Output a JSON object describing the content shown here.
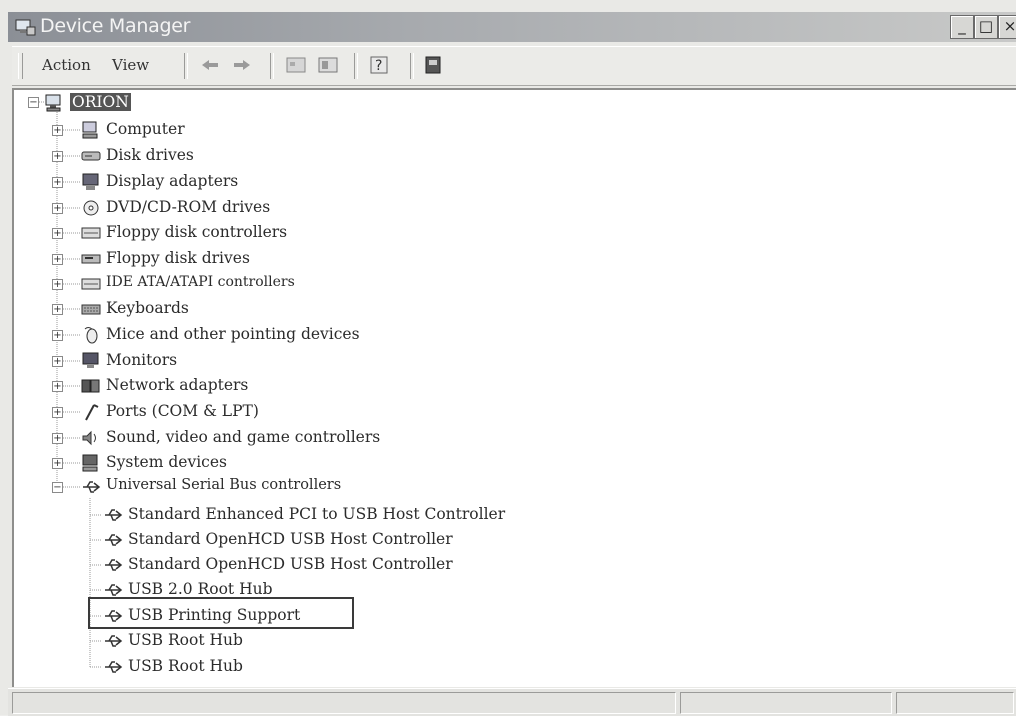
{
  "window": {
    "title": "Device Manager",
    "buttons": [
      "_",
      "□",
      "×"
    ]
  },
  "menu": {
    "action": "Action",
    "view": "View"
  },
  "toolbar": {
    "icons": [
      "back-icon",
      "forward-icon",
      "properties-icon",
      "show-hide-icon",
      "help-icon",
      "scan-hardware-icon"
    ]
  },
  "tree": {
    "root": {
      "label": "ORION",
      "icon": "computer-icon"
    },
    "categories": [
      {
        "label": "Computer",
        "icon": "computer-icon"
      },
      {
        "label": "Disk drives",
        "icon": "disk-drive-icon"
      },
      {
        "label": "Display adapters",
        "icon": "display-adapter-icon"
      },
      {
        "label": "DVD/CD-ROM drives",
        "icon": "cdrom-icon"
      },
      {
        "label": "Floppy disk controllers",
        "icon": "controller-icon"
      },
      {
        "label": "Floppy disk drives",
        "icon": "floppy-drive-icon"
      },
      {
        "label": "IDE ATA/ATAPI controllers",
        "icon": "controller-icon"
      },
      {
        "label": "Keyboards",
        "icon": "keyboard-icon"
      },
      {
        "label": "Mice and other pointing devices",
        "icon": "mouse-icon"
      },
      {
        "label": "Monitors",
        "icon": "monitor-icon"
      },
      {
        "label": "Network adapters",
        "icon": "network-adapter-icon"
      },
      {
        "label": "Ports (COM & LPT)",
        "icon": "port-icon"
      },
      {
        "label": "Sound, video and game controllers",
        "icon": "sound-icon"
      },
      {
        "label": "System devices",
        "icon": "system-device-icon"
      },
      {
        "label": "Universal Serial Bus controllers",
        "icon": "usb-icon"
      }
    ],
    "usb_children": [
      "Standard Enhanced PCI to USB Host Controller",
      "Standard OpenHCD USB Host Controller",
      "Standard OpenHCD USB Host Controller",
      "USB 2.0 Root Hub",
      "USB Printing Support",
      "USB Root Hub",
      "USB Root Hub"
    ],
    "highlighted_item": "USB Printing Support"
  }
}
